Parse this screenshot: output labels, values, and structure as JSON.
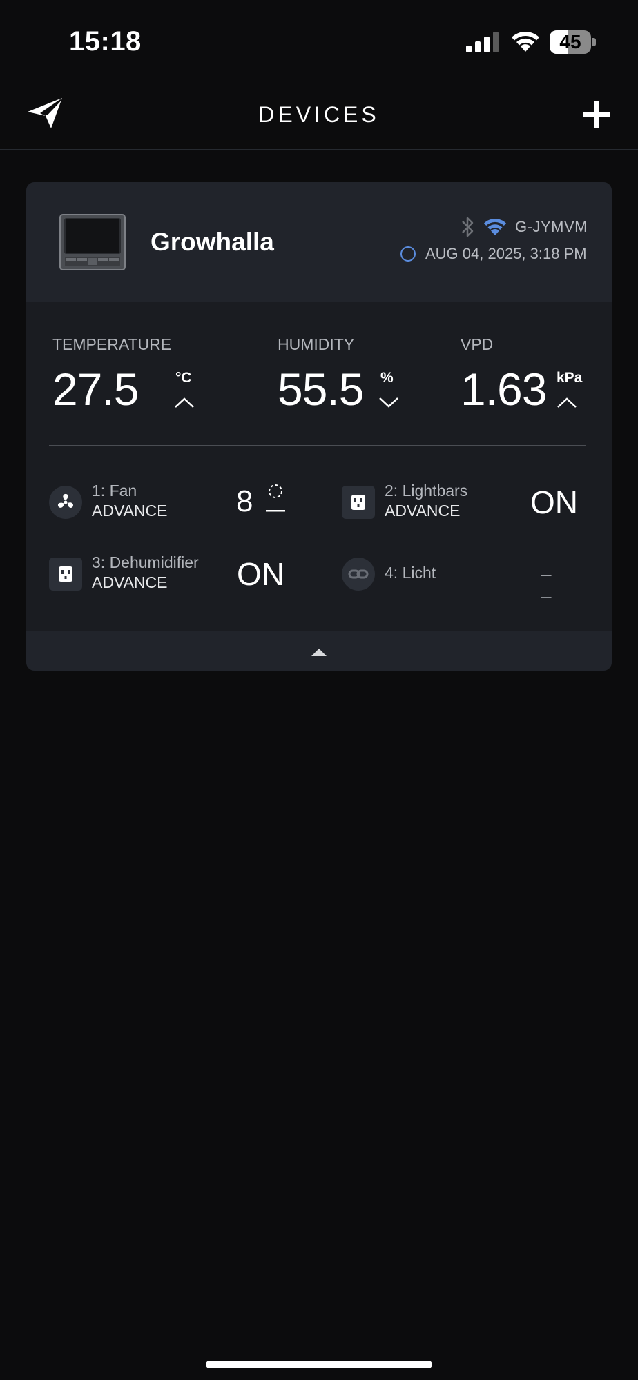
{
  "status_bar": {
    "time": "15:18",
    "battery_level": "45",
    "battery_fraction": 0.45,
    "signal_icon": "cellular-signal-icon",
    "wifi_icon": "wifi-icon"
  },
  "header": {
    "title": "DEVICES",
    "logo_icon": "paper-plane-logo-icon",
    "add_icon": "plus-icon"
  },
  "colors": {
    "background": "#0c0c0d",
    "card": "#1a1c21",
    "card_header": "#21242b",
    "accent_blue": "#5b8ddf",
    "muted_text": "#b4b7bd"
  },
  "device": {
    "name": "Growhalla",
    "id": "G-JYMVM",
    "last_update": "AUG 04, 2025, 3:18 PM",
    "connection_icons": [
      "bluetooth-icon",
      "wifi-icon"
    ],
    "metrics": {
      "temperature": {
        "label": "TEMPERATURE",
        "value": "27.5",
        "unit": "°C",
        "trend": "up"
      },
      "humidity": {
        "label": "HUMIDITY",
        "value": "55.5",
        "unit": "%",
        "trend": "down"
      },
      "vpd": {
        "label": "VPD",
        "value": "1.63",
        "unit": "kPa",
        "trend": "up"
      }
    },
    "ports": [
      {
        "name": "1: Fan",
        "mode": "ADVANCE",
        "state": "8",
        "icon": "fan-icon"
      },
      {
        "name": "2: Lightbars",
        "mode": "ADVANCE",
        "state": "ON",
        "icon": "outlet-icon"
      },
      {
        "name": "3: Dehumidifier",
        "mode": "ADVANCE",
        "state": "ON",
        "icon": "outlet-icon"
      },
      {
        "name": "4: Licht",
        "mode": "",
        "state": "– –",
        "icon": "link-icon"
      }
    ],
    "collapse_icon": "caret-up-icon"
  }
}
